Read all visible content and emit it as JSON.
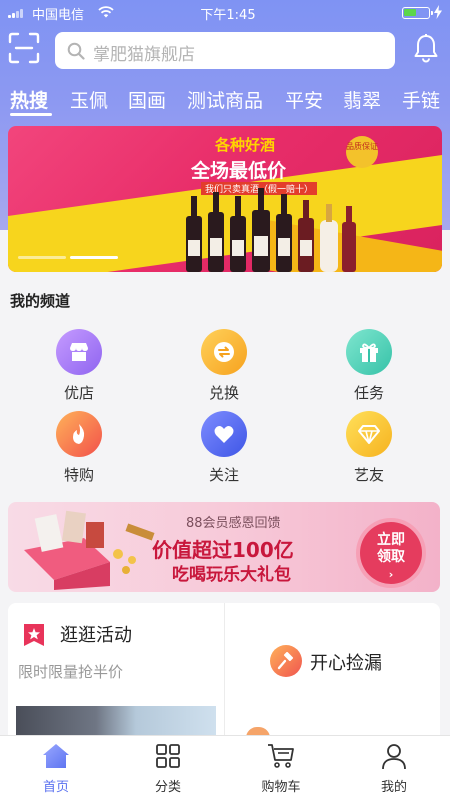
{
  "status_bar": {
    "carrier": "中国电信",
    "time": "下午1:45",
    "battery_level": 0.5
  },
  "header": {
    "scan_icon": "scan-icon",
    "search_placeholder": "掌肥猫旗舰店",
    "notification_icon": "bell-icon"
  },
  "category_tabs": [
    {
      "label": "热搜",
      "active": true
    },
    {
      "label": "玉佩",
      "active": false
    },
    {
      "label": "国画",
      "active": false
    },
    {
      "label": "测试商品",
      "active": false
    },
    {
      "label": "平安",
      "active": false
    },
    {
      "label": "翡翠",
      "active": false
    },
    {
      "label": "手链",
      "active": false
    }
  ],
  "banner": {
    "line1": "各种好酒",
    "line2": "全场最低价",
    "line3": "我们只卖真酒（假一赔十）",
    "badge": "品质保证",
    "active_slide": 1
  },
  "channels": {
    "title": "我的频道",
    "items": [
      {
        "label": "优店",
        "icon": "shop-icon",
        "color": "#a57cf6"
      },
      {
        "label": "兑换",
        "icon": "exchange-icon",
        "color": "#f8b431"
      },
      {
        "label": "任务",
        "icon": "gift-icon",
        "color": "#4fd1b9"
      },
      {
        "label": "特购",
        "icon": "flame-icon",
        "color": "#f77a48"
      },
      {
        "label": "关注",
        "icon": "heart-icon",
        "color": "#5a6ef0"
      },
      {
        "label": "艺友",
        "icon": "diamond-icon",
        "color": "#f8c531"
      }
    ]
  },
  "promo": {
    "line1": "88会员感恩回馈",
    "line2": "价值超过100亿",
    "line3": "吃喝玩乐大礼包",
    "cta": [
      "立即",
      "领取"
    ],
    "cta_arrow": "›"
  },
  "activities": {
    "left": {
      "title": "逛逛活动",
      "subtitle": "限时限量抢半价",
      "icon": "star-flag-icon"
    },
    "right": {
      "title": "开心捡漏",
      "icon": "hammer-icon"
    }
  },
  "tab_bar": [
    {
      "label": "首页",
      "icon": "home-icon",
      "active": true
    },
    {
      "label": "分类",
      "icon": "grid-icon",
      "active": false
    },
    {
      "label": "购物车",
      "icon": "cart-icon",
      "active": false
    },
    {
      "label": "我的",
      "icon": "user-icon",
      "active": false
    }
  ],
  "colors": {
    "accent": "#5b72f0",
    "header_bg": "#8a97f2",
    "banner_bg": "#e82d69"
  }
}
